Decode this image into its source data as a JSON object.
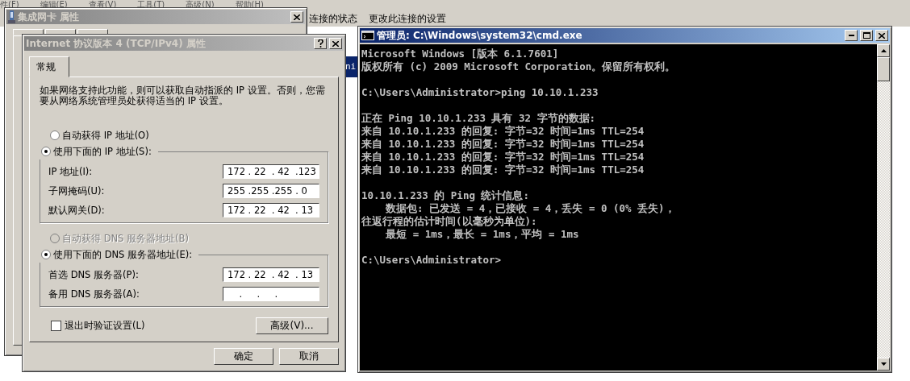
{
  "background_window": {
    "menu": [
      "件(F)",
      "编辑(E)",
      "查看(V)",
      "工具(T)",
      "高级(N)",
      "帮助(H)"
    ],
    "toolbar": [
      "连接的状态",
      "更改此连接的设置"
    ],
    "behind_text": "ni"
  },
  "adapter_dialog": {
    "title": "集成网卡 属性"
  },
  "ipv4_dialog": {
    "title": "Internet 协议版本 4 (TCP/IPv4) 属性",
    "tabs": [
      {
        "label": "常规",
        "selected": true
      }
    ],
    "description": "如果网络支持此功能，则可以获取自动指派的 IP 设置。否则，您需要从网络系统管理员处获得适当的 IP 设置。",
    "ip_group": {
      "options": [
        {
          "label": "自动获得 IP 地址(O)",
          "selected": false,
          "disabled": false
        },
        {
          "label": "使用下面的 IP 地址(S):",
          "selected": true,
          "disabled": false
        }
      ],
      "fields": [
        {
          "label": "IP 地址(I):",
          "value": "172 . 22  . 42  .123"
        },
        {
          "label": "子网掩码(U):",
          "value": "255 .255 .255 . 0"
        },
        {
          "label": "默认网关(D):",
          "value": "172 . 22  . 42  . 13"
        }
      ]
    },
    "dns_group": {
      "options": [
        {
          "label": "自动获得 DNS 服务器地址(B)",
          "selected": false,
          "disabled": true
        },
        {
          "label": "使用下面的 DNS 服务器地址(E):",
          "selected": true,
          "disabled": false
        }
      ],
      "fields": [
        {
          "label": "首选 DNS 服务器(P):",
          "value": "172 . 22  . 42  . 13"
        },
        {
          "label": "备用 DNS 服务器(A):",
          "value": "    .     .     ."
        }
      ]
    },
    "validate_checkbox": {
      "label": "退出时验证设置(L)",
      "checked": false
    },
    "advanced_button": "高级(V)...",
    "buttons": [
      "确定",
      "取消"
    ]
  },
  "cmd_window": {
    "title": "管理员: C:\\Windows\\system32\\cmd.exe",
    "blocks": [
      [
        "Microsoft Windows [版本 6.1.7601]",
        "版权所有 (c) 2009 Microsoft Corporation。保留所有权利。"
      ],
      [
        "C:\\Users\\Administrator>ping 10.10.1.233"
      ],
      [
        "正在 Ping 10.10.1.233 具有 32 字节的数据:",
        "来自 10.10.1.233 的回复: 字节=32 时间=1ms TTL=254",
        "来自 10.10.1.233 的回复: 字节=32 时间=1ms TTL=254",
        "来自 10.10.1.233 的回复: 字节=32 时间=1ms TTL=254",
        "来自 10.10.1.233 的回复: 字节=32 时间=1ms TTL=254"
      ],
      [
        "10.10.1.233 的 Ping 统计信息:",
        "    数据包: 已发送 = 4，已接收 = 4，丢失 = 0 (0% 丢失)，",
        "往返行程的估计时间(以毫秒为单位):",
        "    最短 = 1ms，最长 = 1ms，平均 = 1ms"
      ],
      [
        "C:\\Users\\Administrator>"
      ]
    ]
  }
}
